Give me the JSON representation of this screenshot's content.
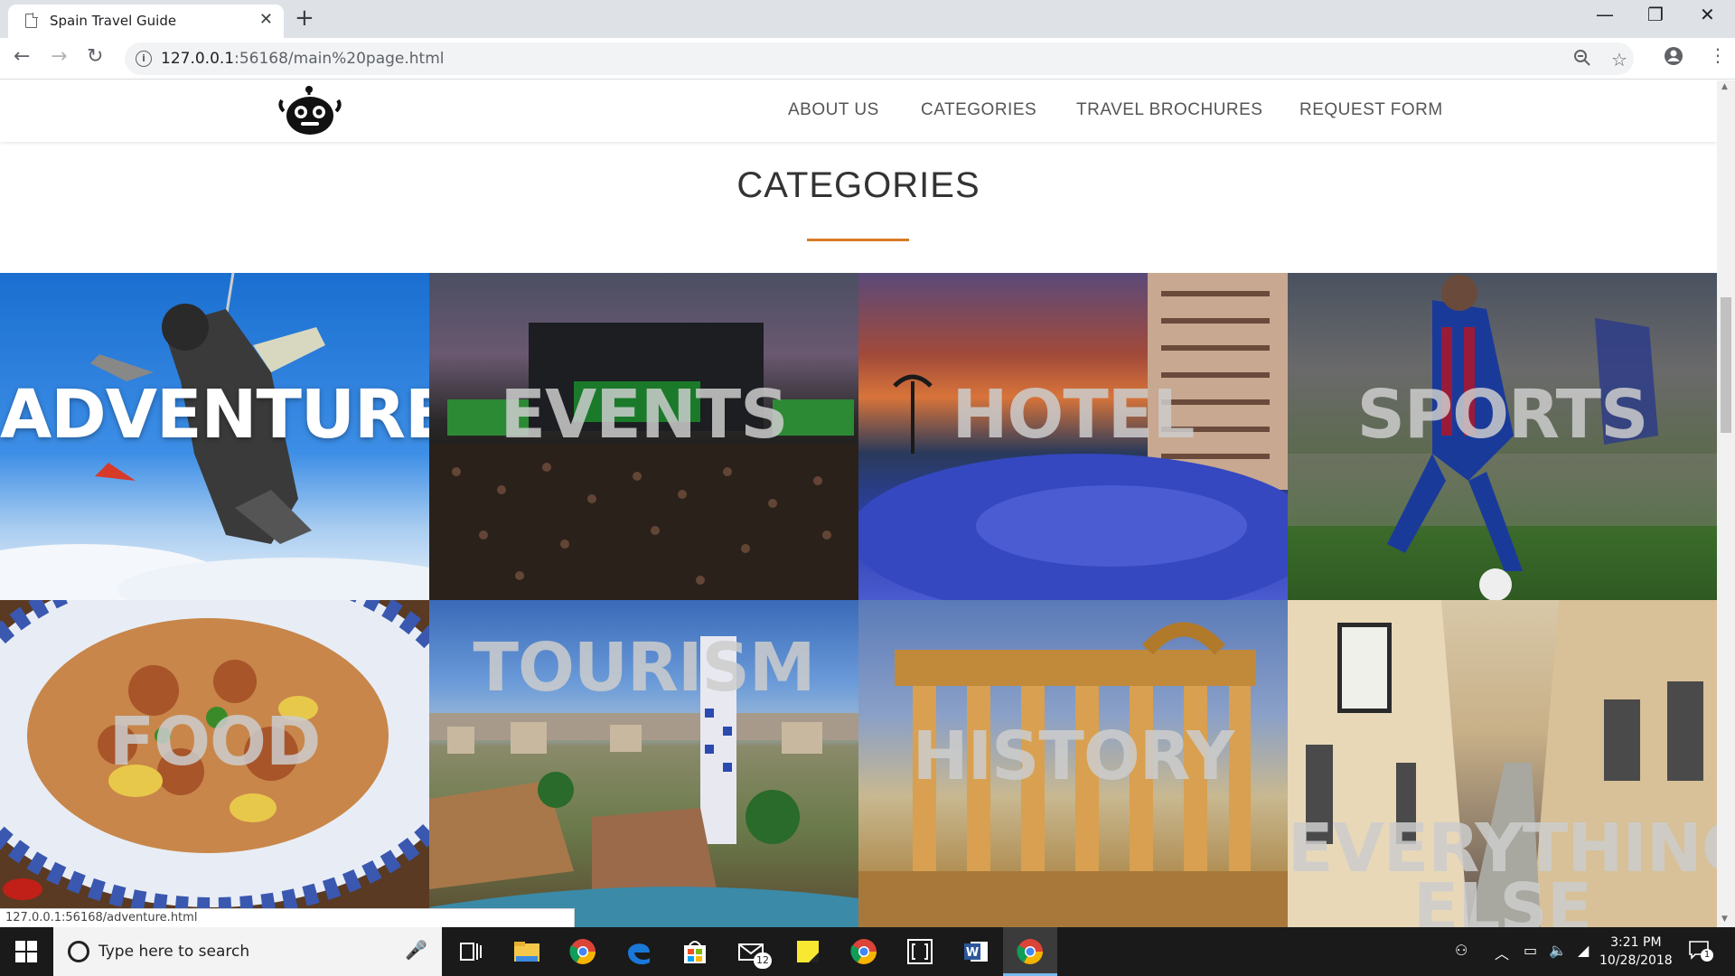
{
  "browser": {
    "tab_title": "Spain Travel Guide",
    "tab_close": "✕",
    "new_tab": "+",
    "url_host": "127.0.0.1",
    "url_path": ":56168/main%20page.html",
    "status_url": "127.0.0.1:56168/adventure.html",
    "window_controls": {
      "minimize": "—",
      "restore": "❐",
      "close": "✕"
    },
    "nav": {
      "back": "←",
      "forward": "→",
      "reload": "↻"
    }
  },
  "site": {
    "nav": [
      "ABOUT US",
      "CATEGORIES",
      "TRAVEL BROCHURES",
      "REQUEST FORM"
    ],
    "section_title": "CATEGORIES",
    "accent_color": "#d87a26",
    "categories": [
      {
        "label": "ADVENTURE"
      },
      {
        "label": "EVENTS"
      },
      {
        "label": "HOTEL"
      },
      {
        "label": "SPORTS"
      },
      {
        "label": "FOOD"
      },
      {
        "label": "TOURISM"
      },
      {
        "label": "HISTORY"
      },
      {
        "label": "EVERYTHING ELSE"
      }
    ]
  },
  "taskbar": {
    "search_placeholder": "Type here to search",
    "mail_badge": "12",
    "time": "3:21 PM",
    "date": "10/28/2018",
    "notification_count": "1"
  }
}
